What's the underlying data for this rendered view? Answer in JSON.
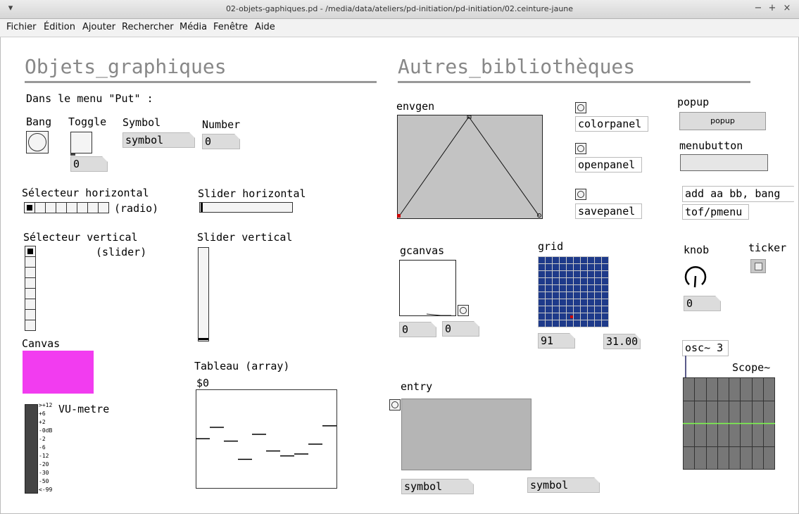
{
  "window": {
    "title": "02-objets-gaphiques.pd  - /media/data/ateliers/pd-initiation/pd-initiation/02.ceinture-jaune",
    "menu": [
      "Fichier",
      "Édition",
      "Ajouter",
      "Rechercher",
      "Média",
      "Fenêtre",
      "Aide"
    ]
  },
  "left": {
    "heading": "Objets_graphiques",
    "intro": "Dans le menu \"Put\" :",
    "bang_label": "Bang",
    "toggle_label": "Toggle",
    "toggle_value": "0",
    "symbol_label": "Symbol",
    "symbol_value": "symbol",
    "number_label": "Number",
    "number_value": "0",
    "hradio_label": "Sélecteur horizontal",
    "hradio_suffix": "(radio)",
    "hslider_label": "Slider horizontal",
    "vradio_label": "Sélecteur vertical",
    "vradio_suffix": "(slider)",
    "vslider_label": "Slider vertical",
    "canvas_label": "Canvas",
    "canvas_color": "#f23cf0",
    "vu_label": "VU-metre",
    "vu_scale": [
      ">+12",
      "+6",
      "+2",
      "-0dB",
      "-2",
      "-6",
      "-12",
      "-20",
      "-30",
      "-50",
      "<-99"
    ],
    "array_label": "Tableau (array)",
    "array_name": "$0",
    "array_values": [
      0.0,
      0.23,
      -0.05,
      -0.42,
      0.09,
      -0.25,
      -0.35,
      -0.31,
      -0.11,
      0.26
    ]
  },
  "right": {
    "heading": "Autres_bibliothèques",
    "envgen_label": "envgen",
    "colorpanel": "colorpanel",
    "openpanel": "openpanel",
    "savepanel": "savepanel",
    "popup_label": "popup",
    "popup_value": "popup",
    "menubutton_label": "menubutton",
    "add_msg": "add aa bb, bang",
    "tof_obj": "tof/pmenu",
    "gcanvas_label": "gcanvas",
    "gcanvas_x": "0",
    "gcanvas_y": "0",
    "grid_label": "grid",
    "grid_x": "91",
    "grid_y": "31.00",
    "grid_color": "#1e3a8a",
    "knob_label": "knob",
    "knob_value": "0",
    "ticker_label": "ticker",
    "osc_obj": "osc~ 3",
    "scope_label": "Scope~",
    "entry_label": "entry",
    "entry_out1": "symbol",
    "entry_out2": "symbol"
  }
}
